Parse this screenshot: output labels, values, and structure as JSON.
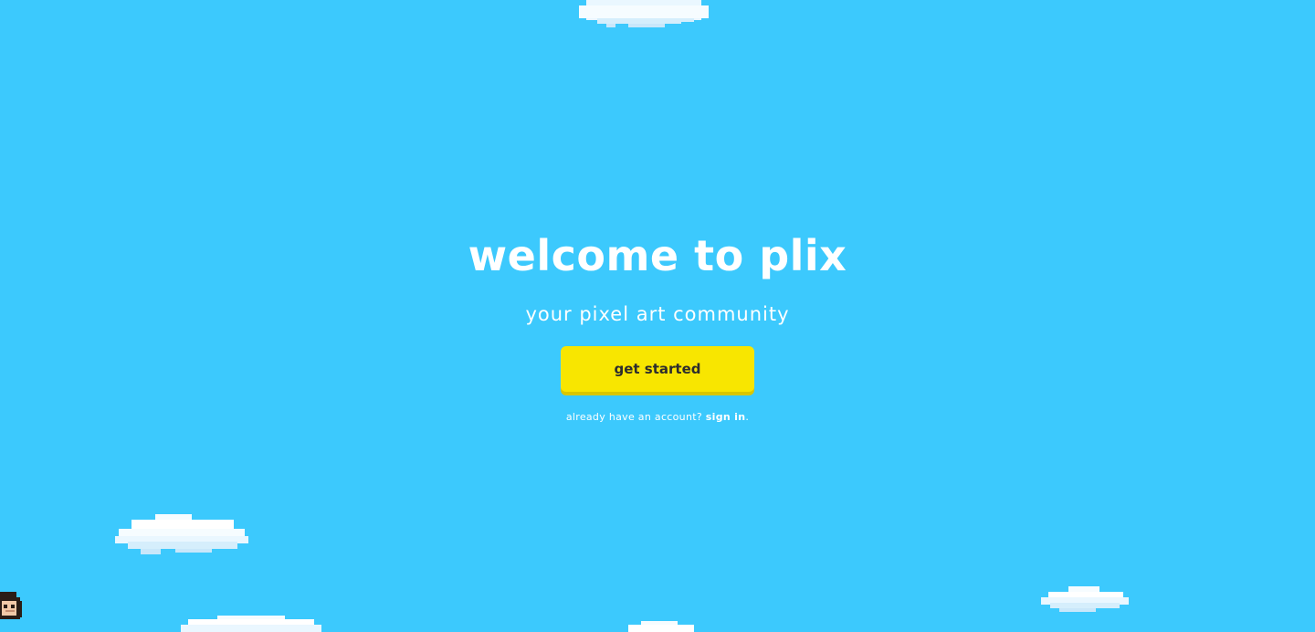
{
  "hero": {
    "title": "welcome to plix",
    "subtitle": "your pixel art community",
    "cta_label": "get started",
    "signin_prompt": "already have an account?",
    "signin_link": "sign in",
    "signin_suffix": "."
  },
  "colors": {
    "sky": "#3cc9fd",
    "cta": "#f8e600",
    "cta_text": "#2d2d2d",
    "cloud": "#ffffff"
  },
  "decor": {
    "cloud_icon": "pixel-cloud",
    "character_icon": "pixel-character"
  }
}
